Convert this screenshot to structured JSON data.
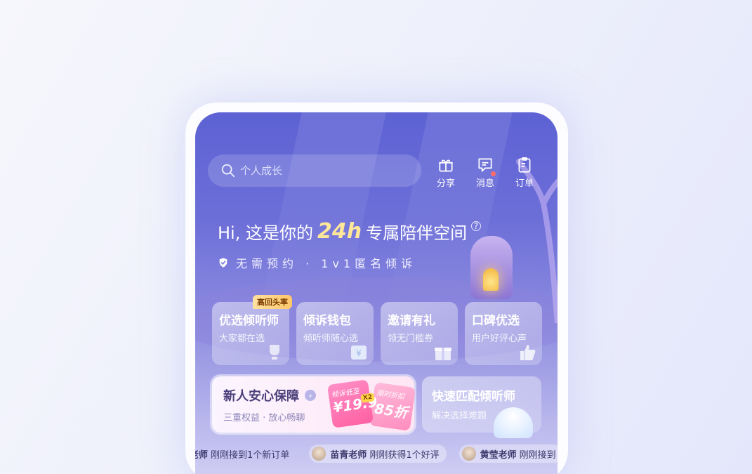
{
  "search": {
    "placeholder": "个人成长"
  },
  "top_actions": [
    {
      "label": "分享",
      "icon": "gift-icon"
    },
    {
      "label": "消息",
      "icon": "message-icon"
    },
    {
      "label": "订单",
      "icon": "clipboard-icon"
    }
  ],
  "hero": {
    "title_prefix": "Hi, 这是你的",
    "title_highlight": "24h",
    "title_suffix": "专属陪伴空间",
    "help_symbol": "?",
    "subtitle": "无需预约 · 1v1匿名倾诉"
  },
  "cards": [
    {
      "title": "优选倾听师",
      "subtitle": "大家都在选",
      "badge": "高回头率",
      "icon": "trophy-icon"
    },
    {
      "title": "倾诉钱包",
      "subtitle": "倾听师随心选",
      "icon": "wallet-icon"
    },
    {
      "title": "邀请有礼",
      "subtitle": "领无门槛券",
      "icon": "gift-box-icon"
    },
    {
      "title": "口碑优选",
      "subtitle": "用户好评心声",
      "icon": "thumbs-up-icon"
    }
  ],
  "promo": {
    "title": "新人安心保障",
    "subtitle": "三重权益 · 放心畅聊",
    "coupon_a": {
      "tag": "倾诉低至",
      "price": "¥19.9",
      "multiplier": "X2"
    },
    "coupon_b": {
      "tag": "限时折扣",
      "price": "85折"
    }
  },
  "match": {
    "title": "快速匹配倾听师",
    "subtitle": "解决选择难题"
  },
  "ticker": [
    {
      "name": "老师",
      "text": "刚刚接到1个新订单"
    },
    {
      "name": "苗青老师",
      "text": "刚刚获得1个好评"
    },
    {
      "name": "黄莹老师",
      "text": "刚刚接到"
    }
  ],
  "colors": {
    "accent": "#5d62d4",
    "highlight": "#ffe79a",
    "badge": "#ffc76b",
    "coupon": "#ff5fa2"
  }
}
